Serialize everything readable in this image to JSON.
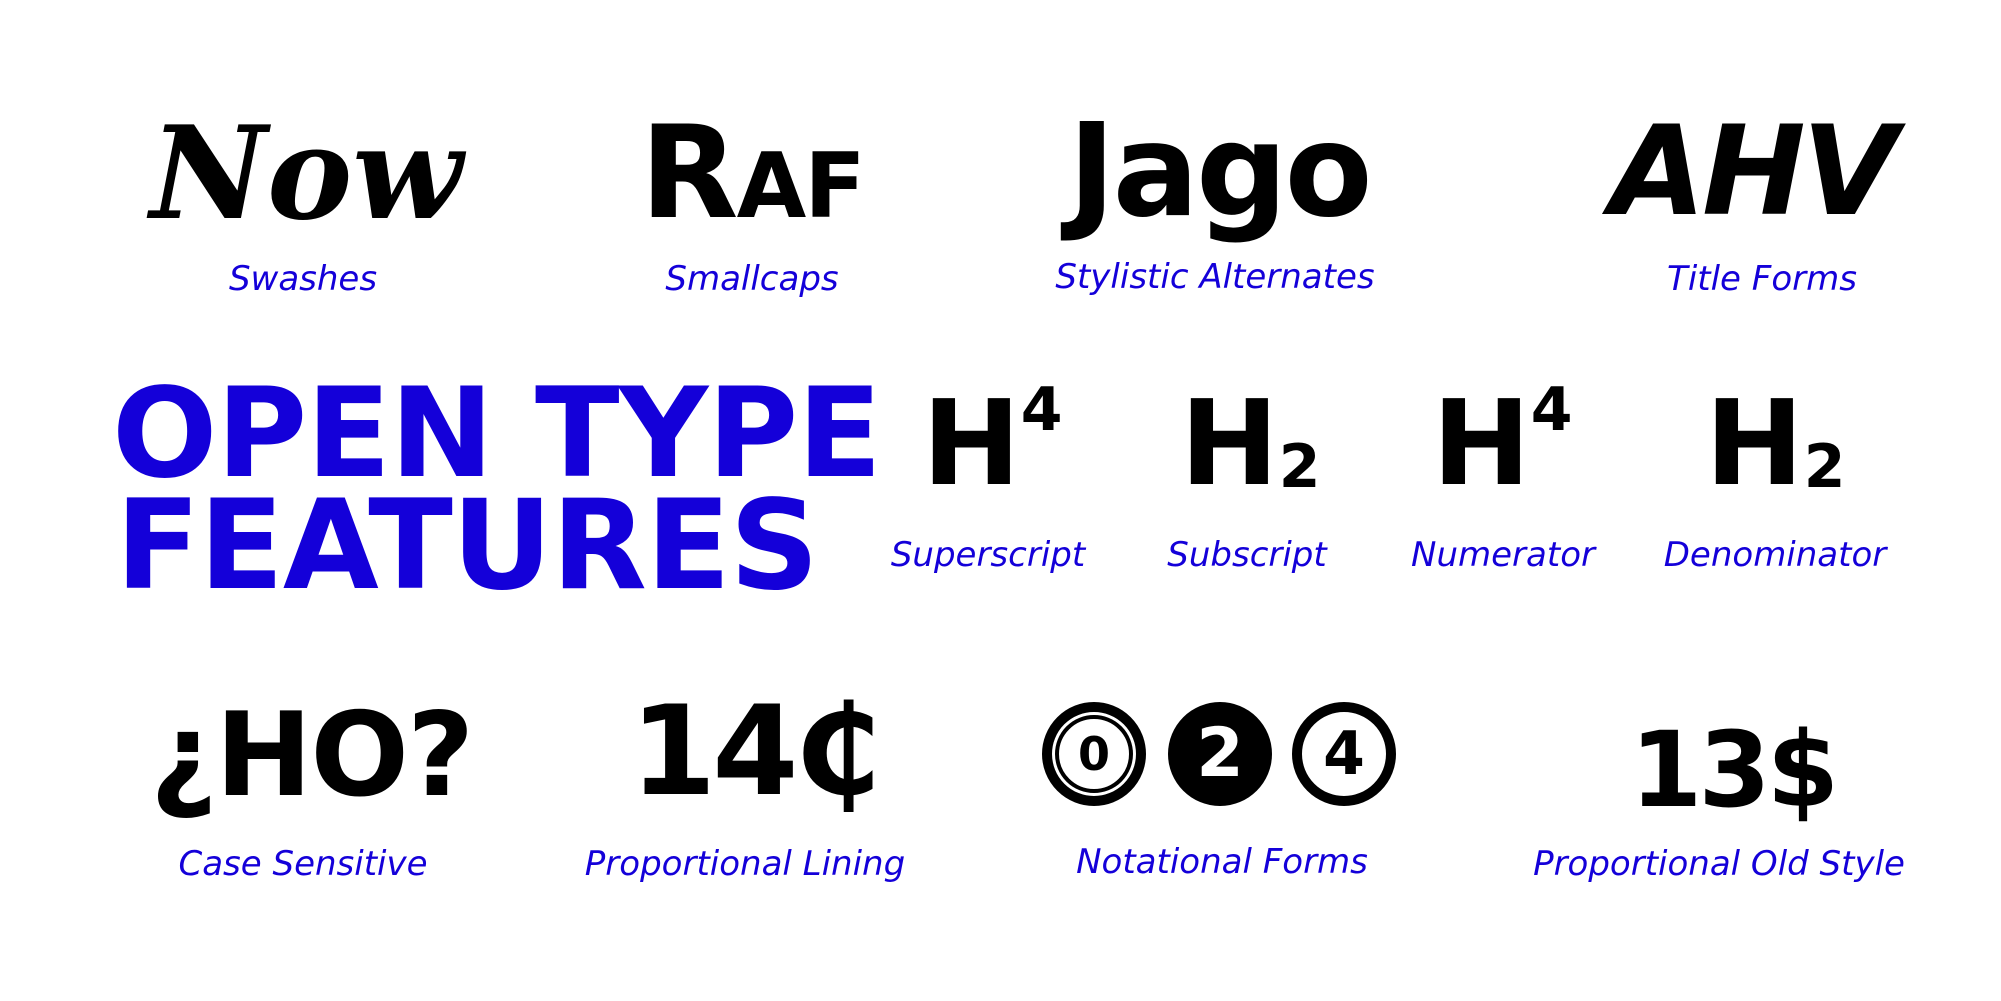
{
  "headline": {
    "line1": "OPEN TYPE",
    "line2": "FEATURES"
  },
  "row1": [
    {
      "sample": "Now",
      "caption": "Swashes"
    },
    {
      "sample": "Raf",
      "caption": "Smallcaps"
    },
    {
      "sample": "Jago",
      "caption": "Stylistic Alternates"
    },
    {
      "sample": "AHV",
      "caption": "Title Forms"
    }
  ],
  "row2": [
    {
      "base": "H",
      "mark": "4",
      "caption": "Superscript"
    },
    {
      "base": "H",
      "mark": "2",
      "caption": "Subscript"
    },
    {
      "base": "H",
      "mark": "4",
      "caption": "Numerator"
    },
    {
      "base": "H",
      "mark": "2",
      "caption": "Denominator"
    }
  ],
  "row3": [
    {
      "sample": "¿HO?",
      "caption": "Case Sensitive"
    },
    {
      "sample": "14₵",
      "caption": "Proportional Lining"
    },
    {
      "circles": [
        "0",
        "2",
        "4"
      ],
      "caption": "Notational Forms"
    },
    {
      "sample": "13$",
      "caption": "Proportional Old Style"
    }
  ],
  "colors": {
    "accent": "#1400d9",
    "text": "#000000",
    "background": "#ffffff"
  }
}
